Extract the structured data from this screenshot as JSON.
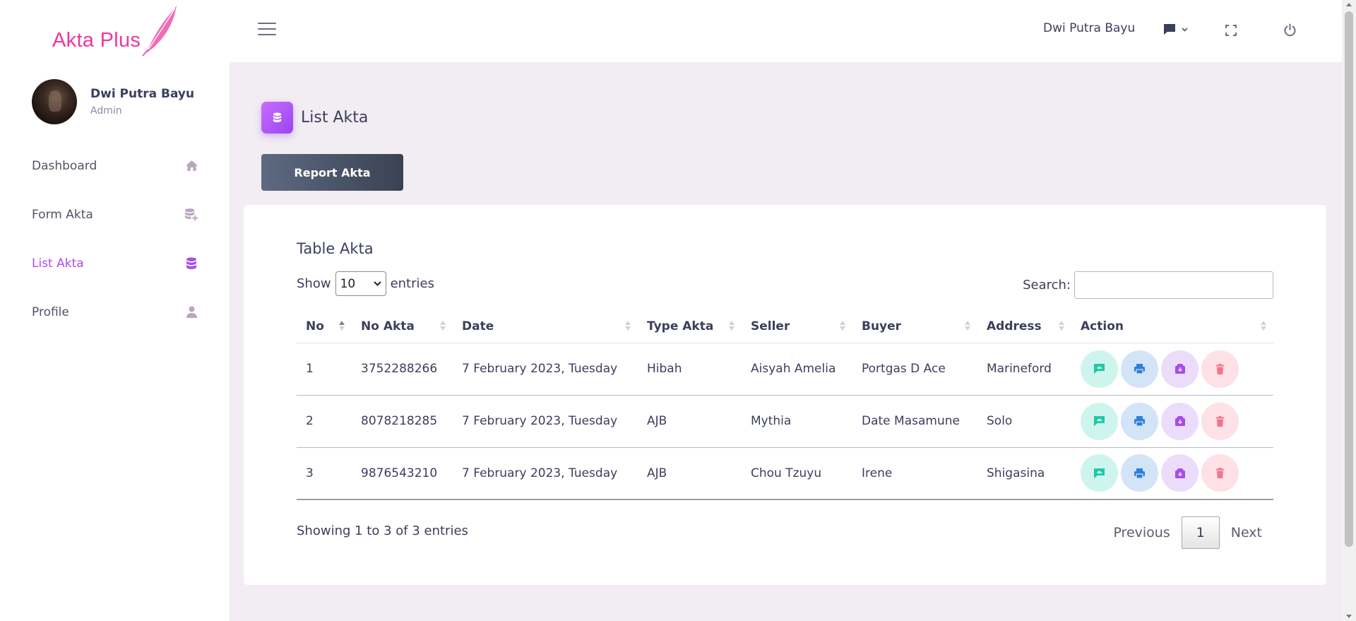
{
  "brand": {
    "name": "Akta Plus",
    "color": "#f0369a"
  },
  "user": {
    "name": "Dwi Putra Bayu",
    "role": "Admin"
  },
  "sidebar": {
    "items": [
      {
        "label": "Dashboard",
        "icon": "home-icon",
        "active": false
      },
      {
        "label": "Form Akta",
        "icon": "database-plus-icon",
        "active": false
      },
      {
        "label": "List Akta",
        "icon": "database-icon",
        "active": true
      },
      {
        "label": "Profile",
        "icon": "user-icon",
        "active": false
      }
    ],
    "active_color": "#b147f3"
  },
  "topbar": {
    "username": "Dwi Putra Bayu",
    "icons": [
      "menu-icon",
      "message-icon",
      "chevron-down-icon",
      "fullscreen-icon",
      "power-icon"
    ]
  },
  "page": {
    "title": "List Akta",
    "icon": "database-icon",
    "report_button": "Report Akta"
  },
  "table_card": {
    "title": "Table Akta",
    "length_label_before": "Show",
    "length_value": "10",
    "length_label_after": "entries",
    "search_label": "Search:",
    "search_value": "",
    "columns": [
      "No",
      "No Akta",
      "Date",
      "Type Akta",
      "Seller",
      "Buyer",
      "Address",
      "Action"
    ],
    "rows": [
      {
        "no": "1",
        "no_akta": "3752288266",
        "date": "7 February 2023, Tuesday",
        "type": "Hibah",
        "seller": "Aisyah Amelia",
        "buyer": "Portgas D Ace",
        "address": "Marineford"
      },
      {
        "no": "2",
        "no_akta": "8078218285",
        "date": "7 February 2023, Tuesday",
        "type": "AJB",
        "seller": "Mythia",
        "buyer": "Date Masamune",
        "address": "Solo"
      },
      {
        "no": "3",
        "no_akta": "9876543210",
        "date": "7 February 2023, Tuesday",
        "type": "AJB",
        "seller": "Chou Tzuyu",
        "buyer": "Irene",
        "address": "Shigasina"
      }
    ],
    "action_icons": [
      "reply-icon",
      "print-icon",
      "archive-download-icon",
      "trash-icon"
    ],
    "info": "Showing 1 to 3 of 3 entries",
    "pagination": {
      "previous": "Previous",
      "current": "1",
      "next": "Next"
    }
  }
}
